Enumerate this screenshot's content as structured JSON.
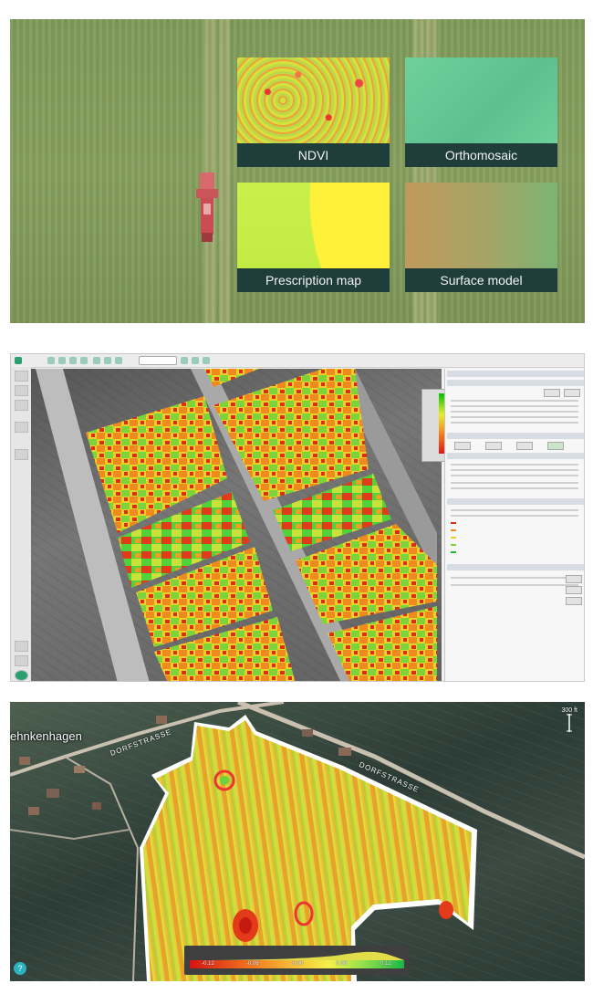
{
  "panel1": {
    "tiles": {
      "ndvi": "NDVI",
      "orthomosaic": "Orthomosaic",
      "prescription": "Prescription map",
      "surface": "Surface model"
    }
  },
  "panel3": {
    "place_name": "ehnkenhagen",
    "street_left": "DORFSTRASSE",
    "street_right": "DORFSTRASSE",
    "scale_label": "300 ft",
    "colorbar_ticks": [
      "-0.12",
      "-0.06",
      "-0.00",
      "0.06",
      "0.12"
    ],
    "help_icon": "?"
  },
  "colors": {
    "caption_bg": "#1f3d3a",
    "ndvi_low": "#d71313",
    "ndvi_high": "#17b845",
    "help_button": "#2cb3c0"
  }
}
